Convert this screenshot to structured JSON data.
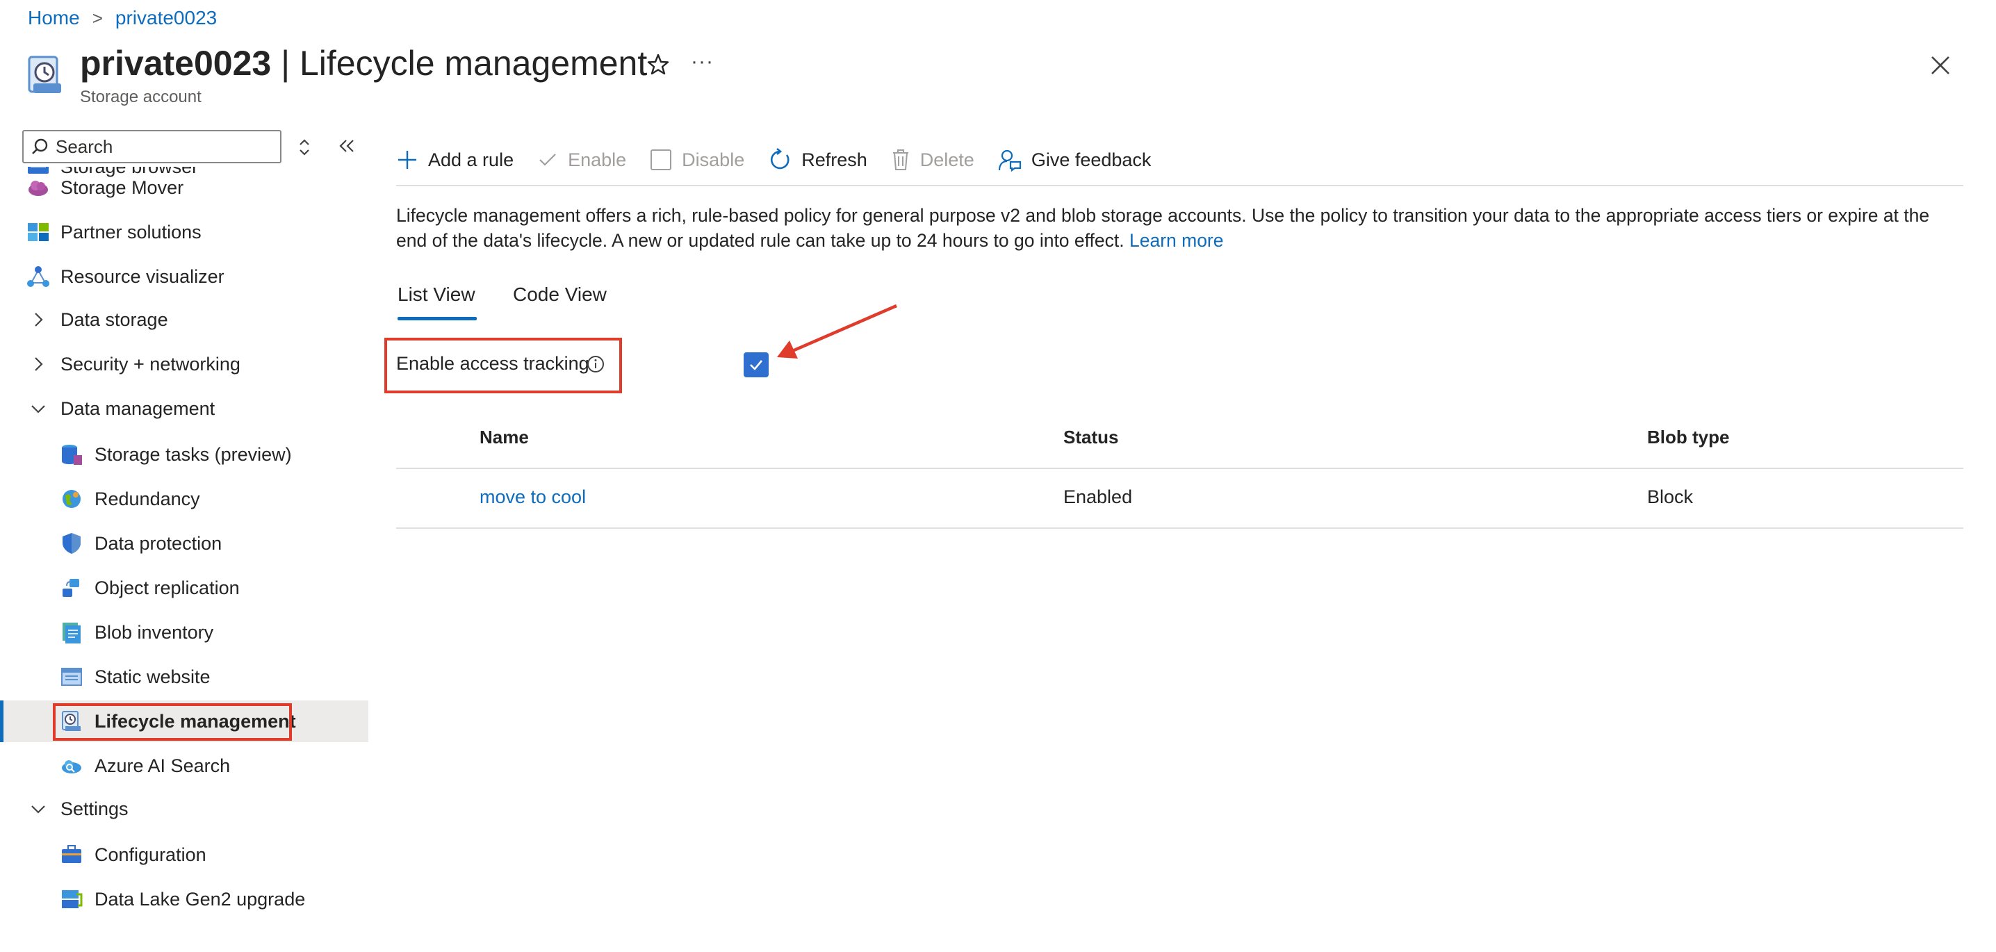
{
  "breadcrumb": {
    "home": "Home",
    "separator": ">",
    "resource": "private0023"
  },
  "header": {
    "resource_name": "private0023",
    "title_separator": " | ",
    "page_name": "Lifecycle management",
    "subtitle": "Storage account",
    "more_label": "···"
  },
  "sidebar": {
    "search_placeholder": "Search",
    "items": [
      {
        "label": "Storage browser",
        "icon": "storage-browser-icon"
      },
      {
        "label": "Storage Mover",
        "icon": "cloud-icon"
      },
      {
        "label": "Partner solutions",
        "icon": "partner-solutions-icon"
      },
      {
        "label": "Resource visualizer",
        "icon": "resource-visualizer-icon"
      },
      {
        "label": "Data storage",
        "icon": "chevron-right-icon"
      },
      {
        "label": "Security + networking",
        "icon": "chevron-right-icon"
      },
      {
        "label": "Data management",
        "icon": "chevron-down-icon"
      },
      {
        "label": "Storage tasks (preview)",
        "icon": "storage-tasks-icon"
      },
      {
        "label": "Redundancy",
        "icon": "globe-icon"
      },
      {
        "label": "Data protection",
        "icon": "shield-icon"
      },
      {
        "label": "Object replication",
        "icon": "object-replication-icon"
      },
      {
        "label": "Blob inventory",
        "icon": "blob-inventory-icon"
      },
      {
        "label": "Static website",
        "icon": "static-website-icon"
      },
      {
        "label": "Lifecycle management",
        "icon": "lifecycle-icon"
      },
      {
        "label": "Azure AI Search",
        "icon": "ai-search-icon"
      },
      {
        "label": "Settings",
        "icon": "chevron-down-icon"
      },
      {
        "label": "Configuration",
        "icon": "briefcase-icon"
      },
      {
        "label": "Data Lake Gen2 upgrade",
        "icon": "data-lake-icon"
      }
    ]
  },
  "toolbar": {
    "add_rule": "Add a rule",
    "enable": "Enable",
    "disable": "Disable",
    "refresh": "Refresh",
    "delete": "Delete",
    "feedback": "Give feedback"
  },
  "description": {
    "text": "Lifecycle management offers a rich, rule-based policy for general purpose v2 and blob storage accounts. Use the policy to transition your data to the appropriate access tiers or expire at the end of the data's lifecycle. A new or updated rule can take up to 24 hours to go into effect.",
    "link": "Learn more"
  },
  "tabs": {
    "list_view": "List View",
    "code_view": "Code View"
  },
  "access_tracking": {
    "label": "Enable access tracking",
    "checked": true
  },
  "table": {
    "headers": {
      "name": "Name",
      "status": "Status",
      "blob_type": "Blob type"
    },
    "rows": [
      {
        "name": "move to cool",
        "status": "Enabled",
        "blob_type": "Block"
      }
    ]
  },
  "colors": {
    "accent": "#0f6cbd",
    "highlight_box": "#e03c2c",
    "checkbox": "#2f6fd0"
  }
}
